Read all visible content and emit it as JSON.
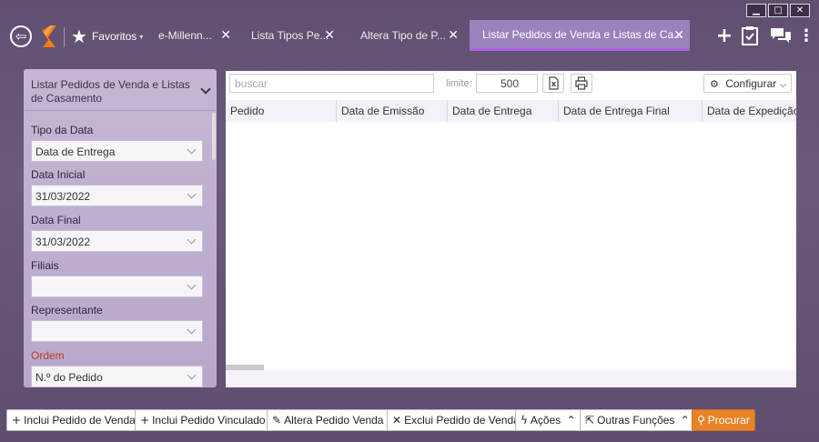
{
  "window": {
    "minimize": "▁",
    "maximize": "□",
    "close": "✕"
  },
  "nav": {
    "favorites_label": "Favoritos",
    "tabs": [
      {
        "label": "e-Millenn..."
      },
      {
        "label": "Lista Tipos Pe..."
      },
      {
        "label": "Altera Tipo de P..."
      },
      {
        "label": "Listar Pedidos de Venda e Listas de Ca..."
      }
    ],
    "active_tab_index": 3
  },
  "filters": {
    "title": "Listar Pedidos de Venda e Listas de Casamento",
    "tipo_data": {
      "label": "Tipo da Data",
      "value": "Data de Entrega"
    },
    "data_inicial": {
      "label": "Data Inicial",
      "value": "31/03/2022"
    },
    "data_final": {
      "label": "Data Final",
      "value": "31/03/2022"
    },
    "filiais": {
      "label": "Filiais",
      "value": ""
    },
    "representante": {
      "label": "Representante",
      "value": ""
    },
    "ordem": {
      "label": "Ordem",
      "value": "N.º do Pedido"
    }
  },
  "grid": {
    "search_placeholder": "buscar",
    "limit_label": "limite:",
    "limit_value": "500",
    "configure_label": "Configurar",
    "columns": [
      "Pedido",
      "Data de Emissão",
      "Data de Entrega",
      "Data de Entrega Final",
      "Data de Expedição"
    ]
  },
  "actions": {
    "inclui_pedido": "Inclui Pedido de Venda",
    "inclui_vinculado": "Inclui Pedido Vinculado",
    "altera_pedido": "Altera Pedido Venda",
    "exclui_pedido": "Exclui Pedido de Venda",
    "acoes": "Ações",
    "outras_funcoes": "Outras Funções",
    "procurar": "Procurar"
  },
  "colors": {
    "accent": "#b061e0",
    "procurar": "#e8832a",
    "required_label": "#c0392b"
  }
}
